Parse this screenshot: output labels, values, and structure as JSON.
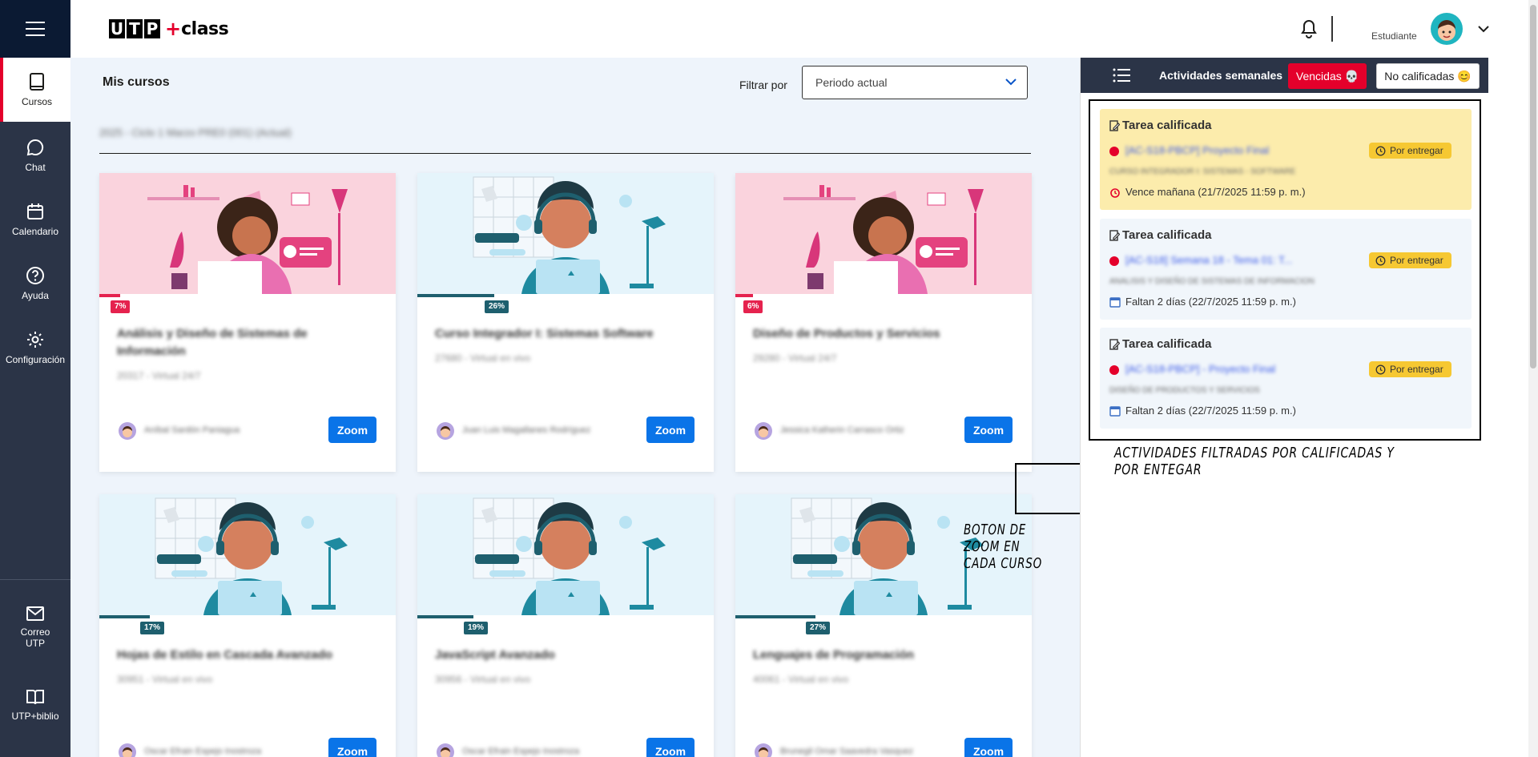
{
  "header": {
    "logo_utp": [
      "U",
      "T",
      "P"
    ],
    "logo_plus": "+",
    "logo_class": "class",
    "role": "Estudiante"
  },
  "sidebar": {
    "items": [
      {
        "label": "Cursos",
        "icon": "book-icon"
      },
      {
        "label": "Chat",
        "icon": "chat-icon"
      },
      {
        "label": "Calendario",
        "icon": "calendar-icon"
      },
      {
        "label": "Ayuda",
        "icon": "help-icon"
      },
      {
        "label": "Configuración",
        "icon": "gear-icon"
      },
      {
        "label_line1": "Correo",
        "label_line2": "UTP",
        "icon": "mail-icon"
      },
      {
        "label": "UTP+biblio",
        "icon": "open-book-icon"
      }
    ]
  },
  "main": {
    "title": "Mis cursos",
    "filter_label": "Filtrar por",
    "filter_value": "Periodo actual",
    "period": "2025 - Ciclo 1 Marzo PRE0 (001) (Actual)"
  },
  "courses": [
    {
      "title": "Análisis y Diseño de Sistemas de Información",
      "subtitle": "20317 - Virtual 24/7",
      "teacher": "Aníbal Sardón Paniagua",
      "progress": 7,
      "progress_label": "7%",
      "zoom": "Zoom"
    },
    {
      "title": "Curso Integrador I: Sistemas Software",
      "subtitle": "27680 - Virtual en vivo",
      "teacher": "Juan Luis Magallanes Rodríguez",
      "progress": 26,
      "progress_label": "26%",
      "zoom": "Zoom"
    },
    {
      "title": "Diseño de Productos y Servicios",
      "subtitle": "29280 - Virtual 24/7",
      "teacher": "Jessica Katherin Carrasco Ortiz",
      "progress": 6,
      "progress_label": "6%",
      "zoom": "Zoom"
    },
    {
      "title": "Hojas de Estilo en Cascada Avanzado",
      "subtitle": "30951 - Virtual en vivo",
      "teacher": "Oscar Efrain Espejo Inostroza",
      "progress": 17,
      "progress_label": "17%",
      "zoom": "Zoom"
    },
    {
      "title": "JavaScript Avanzado",
      "subtitle": "30956 - Virtual en vivo",
      "teacher": "Oscar Efrain Espejo Inostroza",
      "progress": 19,
      "progress_label": "19%",
      "zoom": "Zoom"
    },
    {
      "title": "Lenguajes de Programación",
      "subtitle": "40061 - Virtual en vivo",
      "teacher": "Brunegil Omar Saavedra Vasquez",
      "progress": 27,
      "progress_label": "27%",
      "zoom": "Zoom"
    }
  ],
  "annotations": {
    "zoom_caption": "BOTON DE ZOOM EN CADA CURSO",
    "activities_caption": "ACTIVIDADES FILTRADAS POR CALIFICADAS Y POR ENTEGAR"
  },
  "panel": {
    "title": "Actividades semanales",
    "btn_vencidas": "Vencidas 💀",
    "btn_no_calificadas": "No calificadas 😊",
    "activities": [
      {
        "title": "Tarea calificada",
        "code": "[AC-S18-PBCP] Proyecto Final",
        "course": "CURSO INTEGRADOR I: SISTEMAS - SOFTWARE",
        "due": "Vence mañana (21/7/2025 11:59 p. m.)",
        "badge": "Por entregar",
        "due_icon": "alarm-icon"
      },
      {
        "title": "Tarea calificada",
        "code": "[AC-S18] Semana 18 - Tema 01: T...",
        "course": "ANALISIS Y DISEÑO DE SISTEMAS DE INFORMACION",
        "due": "Faltan 2 días (22/7/2025 11:59 p. m.)",
        "badge": "Por entregar",
        "due_icon": "calendar-icon"
      },
      {
        "title": "Tarea calificada",
        "code": "[AC-S18-PBCP] - Proyecto Final",
        "course": "DISEÑO DE PRODUCTOS Y SERVICIOS",
        "due": "Faltan 2 días (22/7/2025 11:59 p. m.)",
        "badge": "Por entregar",
        "due_icon": "calendar-icon"
      }
    ]
  },
  "colors": {
    "sidebar": "#2b3447",
    "accent_red": "#e4002b",
    "zoom_blue": "#0a74e8",
    "progress_pink": "#e5224e",
    "progress_teal": "#1e5f6e",
    "badge_yellow": "#f6c832"
  }
}
